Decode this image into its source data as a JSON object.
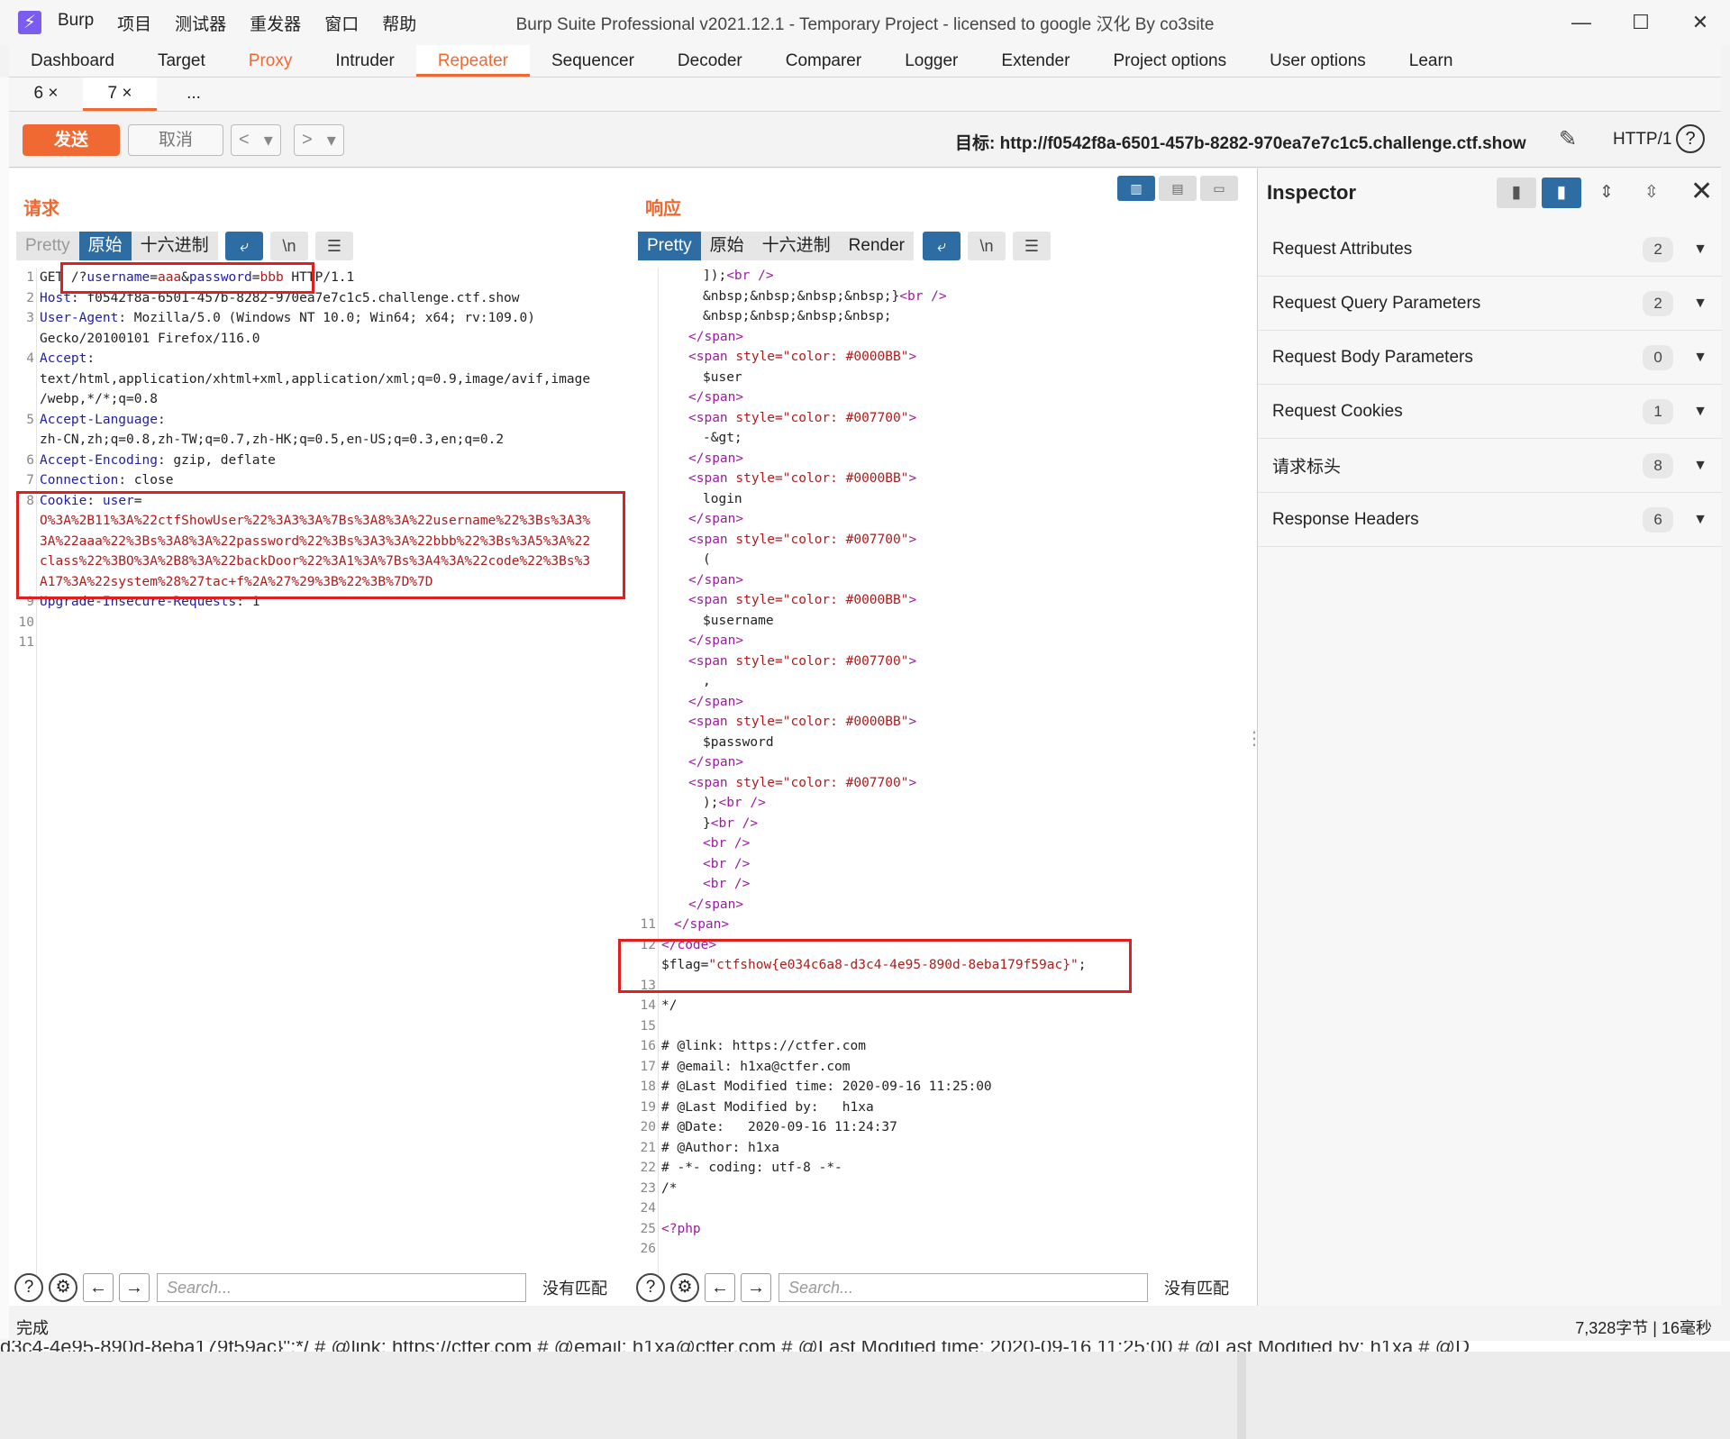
{
  "window": {
    "title": "Burp Suite Professional v2021.12.1 - Temporary Project - licensed to google 汉化 By co3site",
    "menu": [
      "Burp",
      "项目",
      "测试器",
      "重发器",
      "窗口",
      "帮助"
    ],
    "controls": [
      "—",
      "☐",
      "✕"
    ]
  },
  "tabs": {
    "items": [
      "Dashboard",
      "Target",
      "Proxy",
      "Intruder",
      "Repeater",
      "Sequencer",
      "Decoder",
      "Comparer",
      "Logger",
      "Extender",
      "Project options",
      "User options",
      "Learn"
    ]
  },
  "subtabs": {
    "items": [
      "6 ×",
      "7 ×",
      "..."
    ]
  },
  "toolbar": {
    "send": "发送",
    "cancel": "取消",
    "target": "目标: http://f0542f8a-6501-457b-8282-970ea7e7c1c5.challenge.ctf.show",
    "http_version": "HTTP/1"
  },
  "request": {
    "title": "请求",
    "views": [
      "Pretty",
      "原始",
      "十六进制"
    ],
    "active_view": "原始",
    "newline_btn": "\\n",
    "search_placeholder": "Search...",
    "no_match": "没有匹配"
  },
  "response": {
    "title": "响应",
    "views": [
      "Pretty",
      "原始",
      "十六进制",
      "Render"
    ],
    "active_view": "Pretty",
    "newline_btn": "\\n",
    "search_placeholder": "Search...",
    "no_match": "没有匹配"
  },
  "inspector": {
    "title": "Inspector",
    "rows": [
      {
        "label": "Request Attributes",
        "count": "2"
      },
      {
        "label": "Request Query Parameters",
        "count": "2"
      },
      {
        "label": "Request Body Parameters",
        "count": "0"
      },
      {
        "label": "Request Cookies",
        "count": "1"
      },
      {
        "label": "请求标头",
        "count": "8"
      },
      {
        "label": "Response Headers",
        "count": "6"
      }
    ]
  },
  "status": {
    "left": "完成",
    "right": "7,328字节 | 16毫秒"
  },
  "bottom_strip": "d3c4-4e95-890d-8eba179f59ac}\";*/ # @link: https://ctfer.com # @email: h1xa@ctfer.com # @Last Modified time: 2020-09-16 11:25:00 # @Last Modified by: h1xa # @D",
  "colors": {
    "accent": "#f06932",
    "selected": "#2e6da4",
    "highlight_box": "#e02020"
  }
}
